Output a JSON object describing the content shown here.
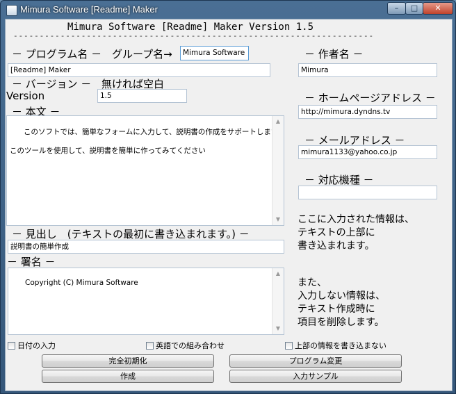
{
  "window": {
    "title": "Mimura Software [Readme] Maker",
    "controls": {
      "minimize": "–",
      "maximize": "□",
      "close": "✕"
    }
  },
  "header": {
    "title": "Mimura Software [Readme] Maker Version 1.5",
    "divider": "---------------------------------------------------------------------"
  },
  "program": {
    "label": "－ プログラム名 －",
    "group_label": "グループ名→",
    "group_value": "Mimura Software",
    "name_value": "[Readme] Maker"
  },
  "version": {
    "label": "－ バージョン －",
    "hint": "無ければ空白",
    "prefix": "Version",
    "value": "1.5"
  },
  "body": {
    "label": "－ 本文 －",
    "text": "このソフトでは、簡単なフォームに入力して、説明書の作成をサポートします\n\nこのツールを使用して、説明書を簡単に作ってみてください"
  },
  "heading": {
    "label": "－ 見出し　(テキストの最初に書き込まれます。) －",
    "value": "説明書の簡単作成"
  },
  "signature": {
    "label": "－ 署名 －",
    "value": "Copyright (C) Mimura Software"
  },
  "author": {
    "label": "－ 作者名 －",
    "value": "Mimura"
  },
  "homepage": {
    "label": "－ ホームページアドレス －",
    "value": "http://mimura.dyndns.tv"
  },
  "email": {
    "label": "－ メールアドレス －",
    "value": "mimura1133@yahoo.co.jp"
  },
  "platform": {
    "label": "－ 対応機種 －",
    "value": ""
  },
  "info": {
    "top": "ここに入力された情報は、\nテキストの上部に\n書き込まれます。",
    "bottom": "また、\n入力しない情報は、\nテキスト作成時に\n項目を削除します。"
  },
  "options": {
    "date": "日付の入力",
    "english": "英語での組み合わせ",
    "no_top_info": "上部の情報を書き込まない"
  },
  "buttons": {
    "reset": "完全初期化",
    "program_change": "プログラム変更",
    "create": "作成",
    "sample": "入力サンプル"
  },
  "scroll": {
    "up": "▲",
    "down": "▼"
  }
}
